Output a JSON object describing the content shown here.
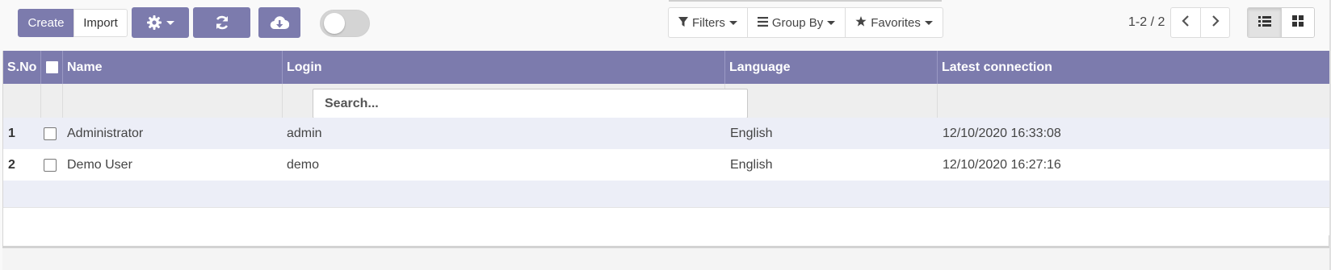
{
  "toolbar": {
    "create_label": "Create",
    "import_label": "Import"
  },
  "search": {
    "filters_label": "Filters",
    "group_by_label": "Group By",
    "favorites_label": "Favorites"
  },
  "pager": {
    "value": "1-2 / 2"
  },
  "colors": {
    "primary": "#7c7bad",
    "row_stripe": "#eceef7"
  },
  "table": {
    "headers": {
      "sno": "S.No",
      "name": "Name",
      "login": "Login",
      "language": "Language",
      "latest_connection": "Latest connection"
    },
    "search_placeholder": "Search...",
    "rows": [
      {
        "sno": "1",
        "name": "Administrator",
        "login": "admin",
        "language": "English",
        "latest_connection": "12/10/2020 16:33:08"
      },
      {
        "sno": "2",
        "name": "Demo User",
        "login": "demo",
        "language": "English",
        "latest_connection": "12/10/2020 16:27:16"
      }
    ]
  }
}
